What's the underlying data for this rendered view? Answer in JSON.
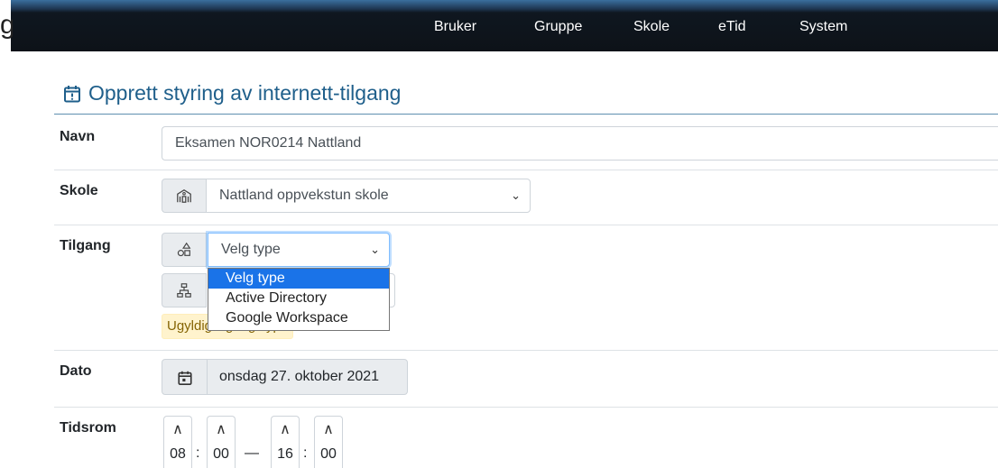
{
  "nav": {
    "brand_fragment": "g",
    "items": [
      "Bruker",
      "Gruppe",
      "Skole",
      "eTid",
      "System"
    ]
  },
  "page": {
    "title": "Opprett styring av internett-tilgang"
  },
  "form": {
    "navn": {
      "label": "Navn",
      "value": "Eksamen NOR0214 Nattland"
    },
    "skole": {
      "label": "Skole",
      "selected": "Nattland oppvekstun skole"
    },
    "tilgang": {
      "label": "Tilgang",
      "type_selected": "Velg type",
      "options": [
        "Velg type",
        "Active Directory",
        "Google Workspace"
      ],
      "warning": "Ugyldig tilgangstype"
    },
    "dato": {
      "label": "Dato",
      "value": "onsdag 27. oktober 2021"
    },
    "tidsrom": {
      "label": "Tidsrom",
      "from_hour": "08",
      "from_minute": "00",
      "to_hour": "16",
      "to_minute": "00",
      "time_sep": ":",
      "range_sep": "—"
    }
  },
  "colors": {
    "accent": "#1f5f8b",
    "nav_bg": "#0d1218",
    "selected_option": "#1a73e8",
    "warning_bg": "#fff3cd"
  },
  "icons": {
    "title": "calendar-alert-icon",
    "skole": "school-icon",
    "tilgang_type": "shapes-icon",
    "tilgang_group": "hierarchy-icon",
    "dato": "calendar-icon",
    "spinner": "chevron-up-icon",
    "select": "chevron-down-icon"
  }
}
